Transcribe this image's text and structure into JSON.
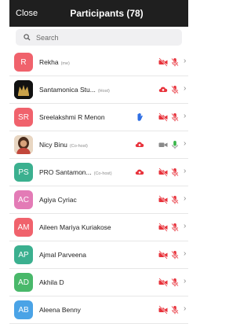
{
  "header": {
    "close_label": "Close",
    "title": "Participants (78)"
  },
  "search": {
    "placeholder": "Search"
  },
  "participants": [
    {
      "initials": "R",
      "name": "Rekha",
      "role": "(me)",
      "avatar_color": "#f0626c",
      "avatar_kind": "initials",
      "icons": [
        "video-off",
        "mic-off"
      ]
    },
    {
      "initials": "",
      "name": "Santamonica Stu...",
      "role": "(Host)",
      "avatar_color": "#1a1a1a",
      "avatar_kind": "logo",
      "icons": [
        "cloud",
        "mic-off"
      ]
    },
    {
      "initials": "SR",
      "name": "Sreelakshmi R Menon",
      "role": "",
      "avatar_color": "#f0626c",
      "avatar_kind": "initials",
      "icons": [
        "hand",
        "video-off",
        "mic-off"
      ]
    },
    {
      "initials": "",
      "name": "Nicy Binu",
      "role": "(Co-host)",
      "avatar_color": "#d9b38c",
      "avatar_kind": "photo",
      "icons": [
        "cloud",
        "video-on",
        "mic-on"
      ]
    },
    {
      "initials": "PS",
      "name": "PRO Santamon...",
      "role": "(Co-host)",
      "avatar_color": "#3bb08f",
      "avatar_kind": "initials",
      "icons": [
        "cloud",
        "video-off",
        "mic-off"
      ]
    },
    {
      "initials": "AC",
      "name": "Agiya Cyriac",
      "role": "",
      "avatar_color": "#e37bb6",
      "avatar_kind": "initials",
      "icons": [
        "video-off",
        "mic-off"
      ]
    },
    {
      "initials": "AM",
      "name": "Aileen Mariya Kuriakose",
      "role": "",
      "avatar_color": "#f0626c",
      "avatar_kind": "initials",
      "icons": [
        "video-off",
        "mic-off"
      ]
    },
    {
      "initials": "AP",
      "name": "Ajmal Parveena",
      "role": "",
      "avatar_color": "#3bb08f",
      "avatar_kind": "initials",
      "icons": [
        "video-off",
        "mic-off"
      ]
    },
    {
      "initials": "AD",
      "name": "Akhila D",
      "role": "",
      "avatar_color": "#49b86a",
      "avatar_kind": "initials",
      "icons": [
        "video-off",
        "mic-off"
      ]
    },
    {
      "initials": "AB",
      "name": "Aleena Benny",
      "role": "",
      "avatar_color": "#4aa3e6",
      "avatar_kind": "initials",
      "icons": [
        "video-off",
        "mic-off"
      ]
    }
  ],
  "colors": {
    "red": "#e8333c",
    "blue": "#2f6fe4",
    "green": "#39b54a",
    "gray": "#8a8a8a"
  },
  "chevron_glyph": "›"
}
